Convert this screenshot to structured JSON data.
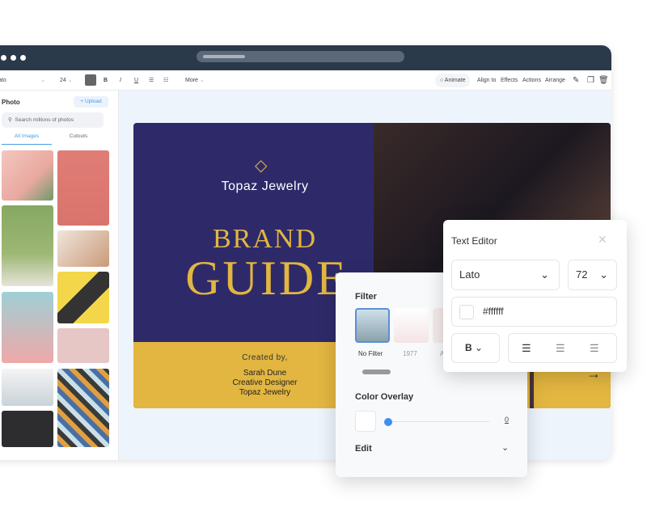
{
  "toolbar": {
    "font": "ato",
    "size": "24",
    "bold": "B",
    "italic": "I",
    "underline": "U",
    "more": "More",
    "animate": "Animate",
    "align_to": "Align to",
    "effects": "Effects",
    "actions": "Actions",
    "arrange": "Arrange"
  },
  "sidebar": {
    "title": "Photo",
    "upload": "+ Upload",
    "search_placeholder": "Search millions of photos",
    "tabs": [
      {
        "label": "All Images",
        "active": true
      },
      {
        "label": "Cutouts"
      }
    ]
  },
  "design": {
    "brand": "Topaz Jewelry",
    "headline1": "BRAND",
    "headline2": "GUIDE",
    "created_by": "Created by,",
    "name": "Sarah Dune",
    "role": "Creative Designer",
    "company": "Topaz Jewelry",
    "colors": {
      "navy": "#2e2a6a",
      "gold": "#e2b640"
    }
  },
  "filter_panel": {
    "title": "Filter",
    "filters": [
      {
        "label": "No Filter",
        "selected": true
      },
      {
        "label": "1977"
      },
      {
        "label": "A"
      }
    ],
    "color_overlay": "Color Overlay",
    "overlay_value": "0",
    "edit": "Edit"
  },
  "text_editor": {
    "title": "Text Editor",
    "font": "Lato",
    "size": "72",
    "color": "#ffffff",
    "weight": "B"
  }
}
